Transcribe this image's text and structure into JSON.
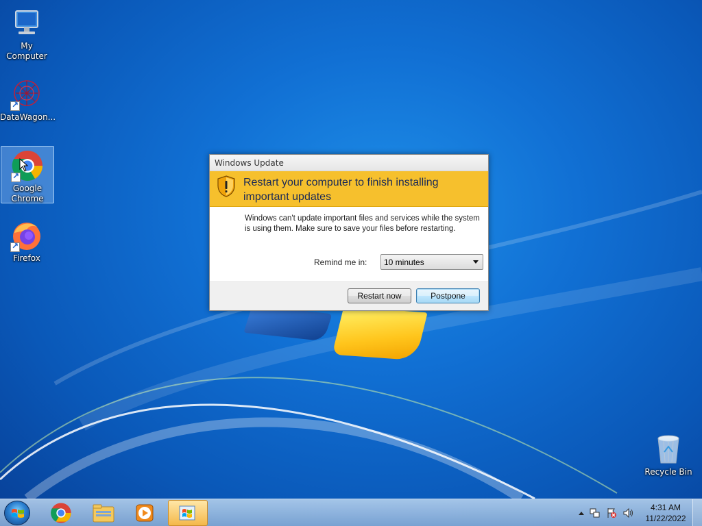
{
  "desktop": {
    "icons": [
      {
        "label": "My Computer",
        "icon": "computer-icon"
      },
      {
        "label": "DataWagon...",
        "icon": "datawagon-icon",
        "shortcut": true
      },
      {
        "label": "Google Chrome",
        "icon": "chrome-icon",
        "shortcut": true,
        "selected": true
      },
      {
        "label": "Firefox",
        "icon": "firefox-icon",
        "shortcut": true
      },
      {
        "label": "Recycle Bin",
        "icon": "recycle-bin-icon"
      }
    ]
  },
  "dialog": {
    "title": "Windows Update",
    "heading": "Restart your computer to finish installing important updates",
    "message": "Windows can't update important files and services while the system is using them. Make sure to save your files before restarting.",
    "remind_label": "Remind me in:",
    "remind_value": "10 minutes",
    "restart_label": "Restart now",
    "postpone_label": "Postpone",
    "banner_color": "#f6c02d"
  },
  "taskbar": {
    "pinned": [
      "start-button",
      "chrome-icon",
      "explorer-icon",
      "media-player-icon",
      "windows-update-icon"
    ],
    "tray": {
      "time": "4:31 AM",
      "date": "11/22/2022"
    }
  }
}
